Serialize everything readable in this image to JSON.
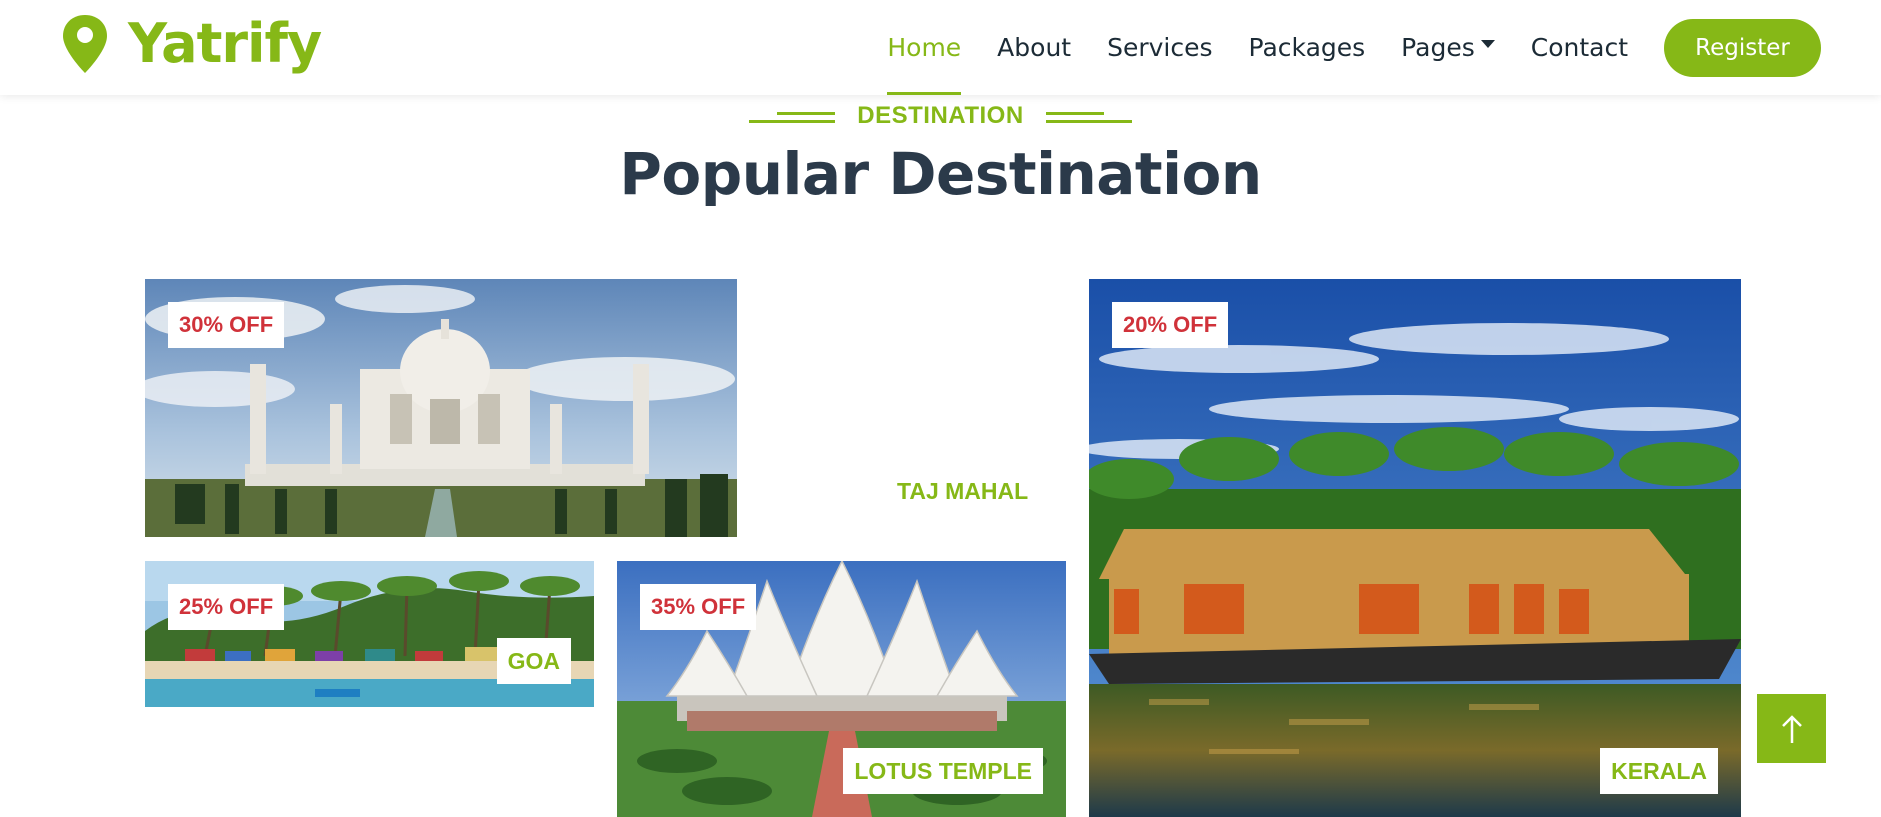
{
  "brand": {
    "name": "Yatrify",
    "color": "#86b817",
    "icon": "map-marker-icon"
  },
  "nav": {
    "items": [
      {
        "label": "Home",
        "active": true
      },
      {
        "label": "About",
        "active": false
      },
      {
        "label": "Services",
        "active": false
      },
      {
        "label": "Packages",
        "active": false
      },
      {
        "label": "Pages",
        "active": false,
        "dropdown": true
      },
      {
        "label": "Contact",
        "active": false
      }
    ],
    "register_label": "Register"
  },
  "section": {
    "kicker": "DESTINATION",
    "title": "Popular Destination"
  },
  "destinations": [
    {
      "name": "TAJ MAHAL",
      "discount": "30% OFF"
    },
    {
      "name": "GOA",
      "discount": "25% OFF"
    },
    {
      "name": "LOTUS TEMPLE",
      "discount": "35% OFF"
    },
    {
      "name": "KERALA",
      "discount": "20% OFF"
    }
  ],
  "back_to_top": {
    "icon": "arrow-up-icon"
  },
  "colors": {
    "accent": "#86b817",
    "discount": "#d0323a",
    "heading": "#2b3a4a",
    "nav_text": "#1c2b36"
  }
}
